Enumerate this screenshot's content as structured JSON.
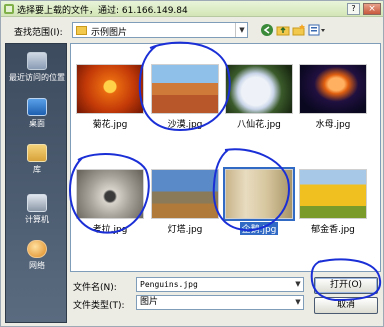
{
  "window": {
    "title": "选择要上载的文件，通过: 61.166.149.84",
    "help_glyph": "?",
    "close_glyph": "×"
  },
  "toolbar": {
    "lookin_label": "查找范围(I):",
    "lookin_value": "示例图片",
    "icons": [
      "back-icon",
      "up-folder-icon",
      "new-folder-icon",
      "views-menu-icon"
    ]
  },
  "places": [
    {
      "label": "最近访问的位置",
      "icon": "recent-places-icon"
    },
    {
      "label": "桌面",
      "icon": "desktop-icon"
    },
    {
      "label": "库",
      "icon": "libraries-icon"
    },
    {
      "label": "计算机",
      "icon": "computer-icon"
    },
    {
      "label": "网络",
      "icon": "network-icon"
    }
  ],
  "files": [
    {
      "name": "菊花.jpg",
      "selected": false
    },
    {
      "name": "沙漠.jpg",
      "selected": false
    },
    {
      "name": "八仙花.jpg",
      "selected": false
    },
    {
      "name": "水母.jpg",
      "selected": false
    },
    {
      "name": "考拉.jpg",
      "selected": false
    },
    {
      "name": "灯塔.jpg",
      "selected": false
    },
    {
      "name": "企鹅.jpg",
      "selected": true
    },
    {
      "name": "郁金香.jpg",
      "selected": false
    }
  ],
  "form": {
    "filename_label": "文件名(N):",
    "filename_value": "Penguins.jpg",
    "filetype_label": "文件类型(T):",
    "filetype_value": "图片",
    "open_label": "打开(O)",
    "cancel_label": "取消"
  },
  "colors": {
    "selection": "#316ac5",
    "annotation_ink": "#1b2fd6",
    "sidebar": "#4a596d"
  }
}
